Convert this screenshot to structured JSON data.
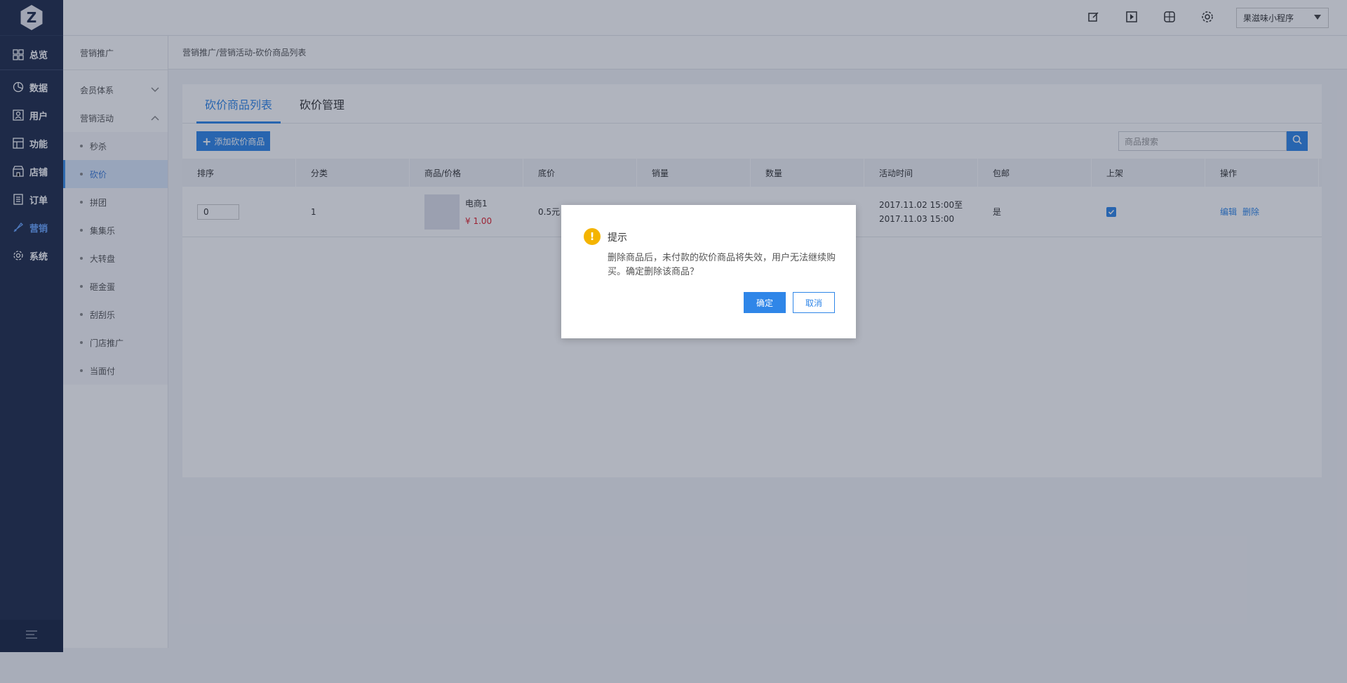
{
  "topbar": {
    "store_name": "果滋味小程序",
    "icons": [
      "edit-icon",
      "preview-icon",
      "network-icon",
      "gear-icon"
    ]
  },
  "leftnav": {
    "items": [
      {
        "label": "总览",
        "icon": "grid-icon"
      },
      {
        "label": "数据",
        "icon": "pie-icon"
      },
      {
        "label": "用户",
        "icon": "user-icon"
      },
      {
        "label": "功能",
        "icon": "layout-icon"
      },
      {
        "label": "店铺",
        "icon": "store-icon"
      },
      {
        "label": "订单",
        "icon": "list-icon"
      },
      {
        "label": "营销",
        "icon": "promo-icon"
      },
      {
        "label": "系统",
        "icon": "gear-icon"
      }
    ],
    "active": "营销"
  },
  "subnav": {
    "title": "营销推广",
    "groups": [
      {
        "label": "会员体系",
        "expanded": false
      },
      {
        "label": "营销活动",
        "expanded": true
      }
    ],
    "children": [
      "秒杀",
      "砍价",
      "拼团",
      "集集乐",
      "大转盘",
      "砸金蛋",
      "刮刮乐",
      "门店推广",
      "当面付"
    ],
    "active_child": "砍价"
  },
  "breadcrumb": "营销推广/营销活动-砍价商品列表",
  "tabs": [
    {
      "label": "砍价商品列表",
      "active": true
    },
    {
      "label": "砍价管理",
      "active": false
    }
  ],
  "toolbar": {
    "add_label": "添加砍价商品",
    "search_placeholder": "商品搜索"
  },
  "table": {
    "headers": [
      "排序",
      "分类",
      "商品/价格",
      "底价",
      "销量",
      "数量",
      "活动时间",
      "包邮",
      "上架",
      "操作"
    ],
    "rows": [
      {
        "sort": "0",
        "category": "1",
        "goods_name": "电商1",
        "goods_price": "¥ 1.00",
        "floor_price": "0.5元",
        "sales": "",
        "quantity": "",
        "time_start": "2017.11.02 15:00至",
        "time_end": "2017.11.03 15:00",
        "free_shipping": "是",
        "on_shelf": true,
        "op_edit": "编辑",
        "op_delete": "删除"
      }
    ]
  },
  "dialog": {
    "title": "提示",
    "message": "删除商品后，未付款的砍价商品将失效，用户无法继续购买。确定删除该商品？",
    "ok_label": "确定",
    "cancel_label": "取消"
  },
  "colors": {
    "nav_bg": "#1f2c4b",
    "accent": "#2f86e8",
    "price": "#e0232d",
    "warn": "#f4b400"
  }
}
